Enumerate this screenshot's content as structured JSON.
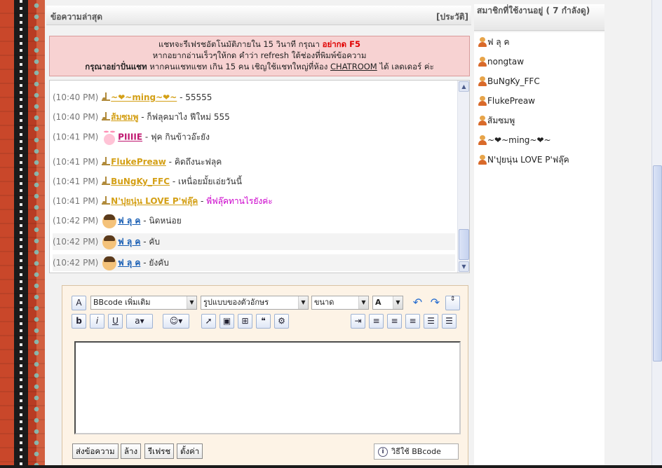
{
  "panel": {
    "title": "ข้อความล่าสุด",
    "history_link": "[ประวัติ]"
  },
  "notice": {
    "line1_text": "แชทจะรีเฟรชอัตโนมัติภายใน 15 วินาที กรุณา ",
    "line1_warning": "อย่ากด F5",
    "line2": "หากอยากอ่านเร็วๆให้กด คำว่า refresh ใต้ช่องที่พิมพ์ข้อความ",
    "line3_bold": "กรุณาอย่าปั่นแชท",
    "line3_text": " หากคนแชทแชท เกิน 15 คน เชิญใช้แชทใหญ่ที่ห้อง ",
    "line3_link": "CHATROOM",
    "line3_end": " ได้ เลดเดอร์ ค่ะ"
  },
  "messages": [
    {
      "time": "(10:40 PM)",
      "user": "~❤~ming~❤~",
      "text": "55555",
      "user_color": "#d4a017",
      "icon": "music-note-icon",
      "text_color": "#333333"
    },
    {
      "time": "(10:40 PM)",
      "user": "ส้มซมพู",
      "text": "ก็ฟลุคมาไง ฟีใหม่ 555",
      "user_color": "#d4a017",
      "icon": "music-note-icon",
      "text_color": "#333333"
    },
    {
      "time": "(10:41 PM)",
      "user": "PIIIIE",
      "text": "ฟุค กินข้าวอ๊ะยัง",
      "user_color": "#c01870",
      "icon": "bunny-icon",
      "text_color": "#333333"
    },
    {
      "time": "(10:41 PM)",
      "user": "FlukePreaw",
      "text": "คิดถึงนะฟลุค",
      "user_color": "#d4a017",
      "icon": "music-note-icon",
      "text_color": "#333333"
    },
    {
      "time": "(10:41 PM)",
      "user": "BuNgKy_FFC",
      "text": "เหนื่อยมั้ยเอ่ยวันนี้",
      "user_color": "#d4a017",
      "icon": "music-note-icon",
      "text_color": "#333333"
    },
    {
      "time": "(10:41 PM)",
      "user": "N'ปุยนุ่น LOVE P'ฟลุ๊ค",
      "text": "พี่ฟลุ๊คทานไรยังค่ะ",
      "user_color": "#d4a017",
      "icon": "music-note-icon",
      "text_color": "#cc00cc"
    },
    {
      "time": "(10:42 PM)",
      "user": "ฟ ลุ ค",
      "text": "นิดหน่อย",
      "user_color": "#1a5fb4",
      "icon": "boy-avatar-icon",
      "text_color": "#333333"
    },
    {
      "time": "(10:42 PM)",
      "user": "ฟ ลุ ค",
      "text": "คับ",
      "user_color": "#1a5fb4",
      "icon": "boy-avatar-icon",
      "text_color": "#333333"
    },
    {
      "time": "(10:42 PM)",
      "user": "ฟ ลุ ค",
      "text": "ยังคับ",
      "user_color": "#1a5fb4",
      "icon": "boy-avatar-icon",
      "text_color": "#333333"
    }
  ],
  "editor": {
    "bbcode_select": "BBcode เพิ่มเติม",
    "font_select": "รูปแบบของตัวอักษร",
    "size_select": "ขนาด",
    "color_select": "A",
    "buttons": {
      "send": "ส่งข้อความ",
      "clear": "ล้าง",
      "refresh": "รีเฟรช",
      "settings": "ตั้งค่า"
    },
    "help_text": "วิธีใช้ BBcode"
  },
  "members": {
    "title": "สมาชิกที่ใช้งานอยู่ ( 7 กำลังดู)",
    "list": [
      "ฟ ลุ ค",
      "nongtaw",
      "BuNgKy_FFC",
      "FlukePreaw",
      "ส้มซมพู",
      "~❤~ming~❤~",
      "N'ปุยนุ่น LOVE P'ฟลุ๊ค"
    ]
  }
}
